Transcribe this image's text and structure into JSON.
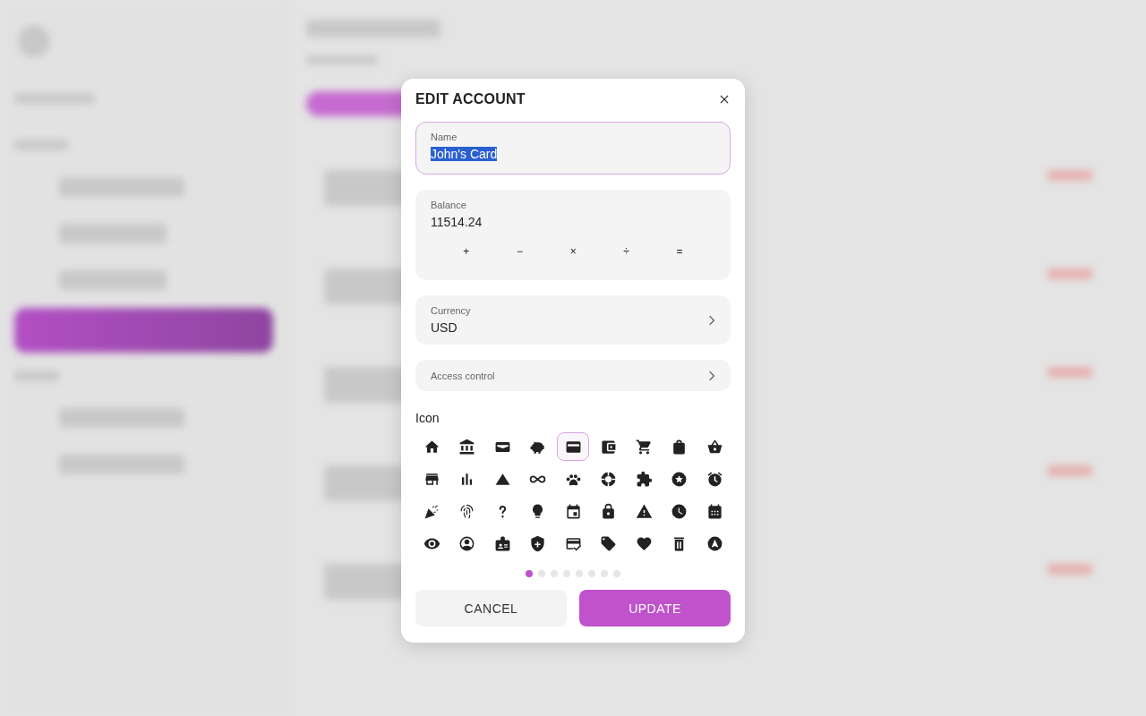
{
  "dialog": {
    "title": "EDIT ACCOUNT",
    "name_field": {
      "label": "Name",
      "value": "John's Card",
      "focused": true,
      "text_selected": true
    },
    "balance_field": {
      "label": "Balance",
      "value": "11514.24",
      "keys": [
        "+",
        "−",
        "×",
        "÷",
        "="
      ]
    },
    "currency_field": {
      "label": "Currency",
      "value": "USD"
    },
    "access_control": {
      "label": "Access control"
    },
    "icon_picker": {
      "label": "Icon",
      "icons": [
        {
          "selected": false
        },
        {
          "selected": false
        },
        {
          "selected": false
        },
        {
          "selected": false
        },
        {
          "selected": true
        },
        {
          "selected": false
        },
        {
          "selected": false
        },
        {
          "selected": false
        },
        {
          "selected": false
        },
        {
          "selected": false
        },
        {
          "selected": false
        },
        {
          "selected": false
        },
        {
          "selected": false
        },
        {
          "selected": false
        },
        {
          "selected": false
        },
        {
          "selected": false
        },
        {
          "selected": false
        },
        {
          "selected": false
        },
        {
          "selected": false
        },
        {
          "selected": false
        },
        {
          "selected": false
        },
        {
          "selected": false
        },
        {
          "selected": false
        },
        {
          "selected": false
        },
        {
          "selected": false
        },
        {
          "selected": false
        },
        {
          "selected": false
        },
        {
          "selected": false
        },
        {
          "selected": false
        },
        {
          "selected": false
        },
        {
          "selected": false
        },
        {
          "selected": false
        },
        {
          "selected": false
        },
        {
          "selected": false
        },
        {
          "selected": false
        },
        {
          "selected": false
        }
      ],
      "pages": [
        {
          "selected": true
        },
        {
          "selected": false
        },
        {
          "selected": false
        },
        {
          "selected": false
        },
        {
          "selected": false
        },
        {
          "selected": false
        },
        {
          "selected": false
        },
        {
          "selected": false
        }
      ]
    },
    "buttons": [
      {
        "label": "CANCEL",
        "kind": "secondary"
      },
      {
        "label": "UPDATE",
        "kind": "primary"
      }
    ]
  }
}
